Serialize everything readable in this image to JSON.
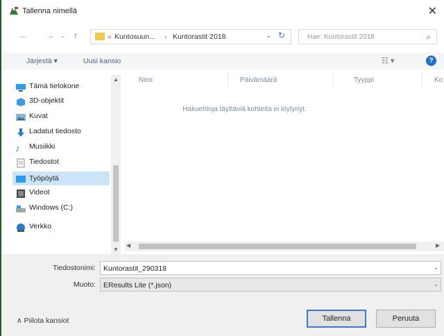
{
  "window": {
    "title": "Tallenna nimellä",
    "close_icon": "close-icon"
  },
  "nav": {
    "breadcrumb": [
      "Kuntosuun...",
      "Kuntorastit 2018"
    ],
    "breadcrumb_prefix": "«",
    "search_placeholder": "Hae: Kuntorastit 2018"
  },
  "toolbar": {
    "organize": "Järjestä ▾",
    "new_folder": "Uusi kansio",
    "help": "?"
  },
  "sidebar": {
    "items": [
      {
        "label": "Tämä tietokone",
        "icon": "computer-icon"
      },
      {
        "label": "3D-objektit",
        "icon": "3d-objects-icon"
      },
      {
        "label": "Kuvat",
        "icon": "pictures-icon"
      },
      {
        "label": "Ladatut tiedosto",
        "icon": "downloads-icon"
      },
      {
        "label": "Musiikki",
        "icon": "music-icon"
      },
      {
        "label": "Tiedostot",
        "icon": "documents-icon"
      },
      {
        "label": "Työpöytä",
        "icon": "desktop-icon",
        "selected": true
      },
      {
        "label": "Videot",
        "icon": "videos-icon"
      },
      {
        "label": "Windows (C:)",
        "icon": "drive-icon"
      },
      {
        "label": "Verkko",
        "icon": "network-icon"
      }
    ]
  },
  "content": {
    "columns": [
      "Nimi",
      "Päivämäärä",
      "Tyyppi",
      "Ko"
    ],
    "empty_message": "Hakuehtoja täyttäviä kohteita ei löytynyt."
  },
  "footer": {
    "filename_label": "Tiedostonimi:",
    "filename_value": "Kuntorastit_290318",
    "format_label": "Muoto:",
    "format_value": "EResults Lite (*.json)",
    "hide_folders": "Piilota kansiot",
    "save": "Tallenna",
    "cancel": "Peruuta"
  },
  "colors": {
    "accent": "#1f6fd1",
    "selected_bg": "#cce4f7",
    "folder": "#f2c94c"
  }
}
